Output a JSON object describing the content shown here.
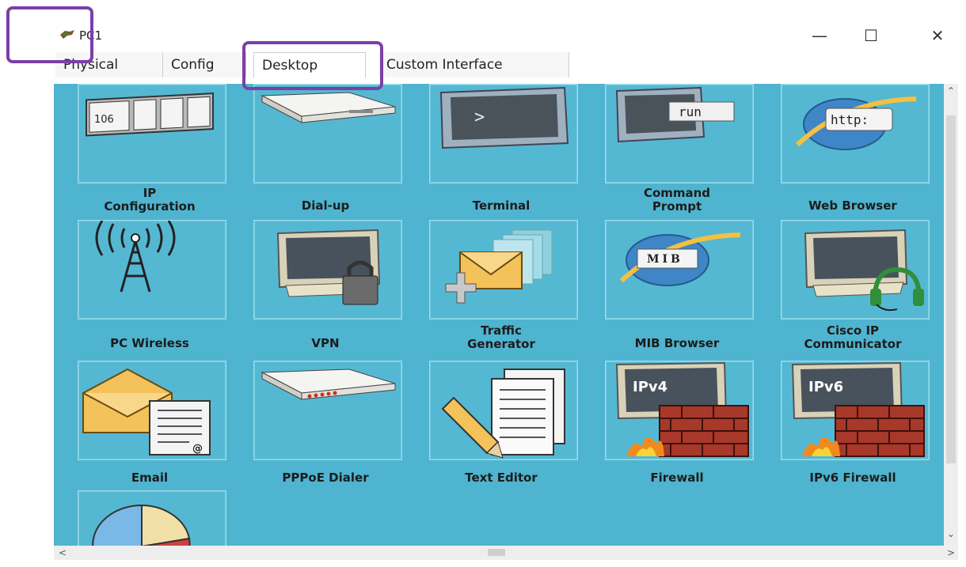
{
  "window": {
    "title": "PC1",
    "minimize": "—",
    "maximize": "☐",
    "close": "✕"
  },
  "tabs": [
    {
      "label": "Physical",
      "active": false
    },
    {
      "label": "Config",
      "active": false
    },
    {
      "label": "Desktop",
      "active": true
    },
    {
      "label": "Custom Interface",
      "active": false
    }
  ],
  "apps": [
    {
      "label": "IP\nConfiguration",
      "icon": "ip-configuration-icon",
      "tile_text": "106"
    },
    {
      "label": "Dial-up",
      "icon": "dial-up-modem-icon"
    },
    {
      "label": "Terminal",
      "icon": "terminal-icon",
      "tile_text": ">"
    },
    {
      "label": "Command\nPrompt",
      "icon": "command-prompt-icon",
      "tile_text": "run"
    },
    {
      "label": "Web Browser",
      "icon": "web-browser-icon",
      "tile_text": "http:"
    },
    {
      "label": "PC Wireless",
      "icon": "wireless-tower-icon"
    },
    {
      "label": "VPN",
      "icon": "vpn-lock-icon"
    },
    {
      "label": "Traffic\nGenerator",
      "icon": "traffic-generator-icon"
    },
    {
      "label": "MIB Browser",
      "icon": "mib-browser-icon",
      "tile_text": "MIB"
    },
    {
      "label": "Cisco IP\nCommunicator",
      "icon": "ip-communicator-headset-icon"
    },
    {
      "label": "Email",
      "icon": "email-icon",
      "tile_text": "@"
    },
    {
      "label": "PPPoE Dialer",
      "icon": "pppoe-dialer-icon"
    },
    {
      "label": "Text Editor",
      "icon": "text-editor-icon"
    },
    {
      "label": "Firewall",
      "icon": "firewall-ipv4-icon",
      "tile_text": "IPv4"
    },
    {
      "label": "IPv6 Firewall",
      "icon": "firewall-ipv6-icon",
      "tile_text": "IPv6"
    },
    {
      "label": "",
      "icon": "pie-chart-app-icon"
    }
  ],
  "colors": {
    "desktop_bg": "#4fb4cf",
    "highlight": "#7b3fa8"
  }
}
